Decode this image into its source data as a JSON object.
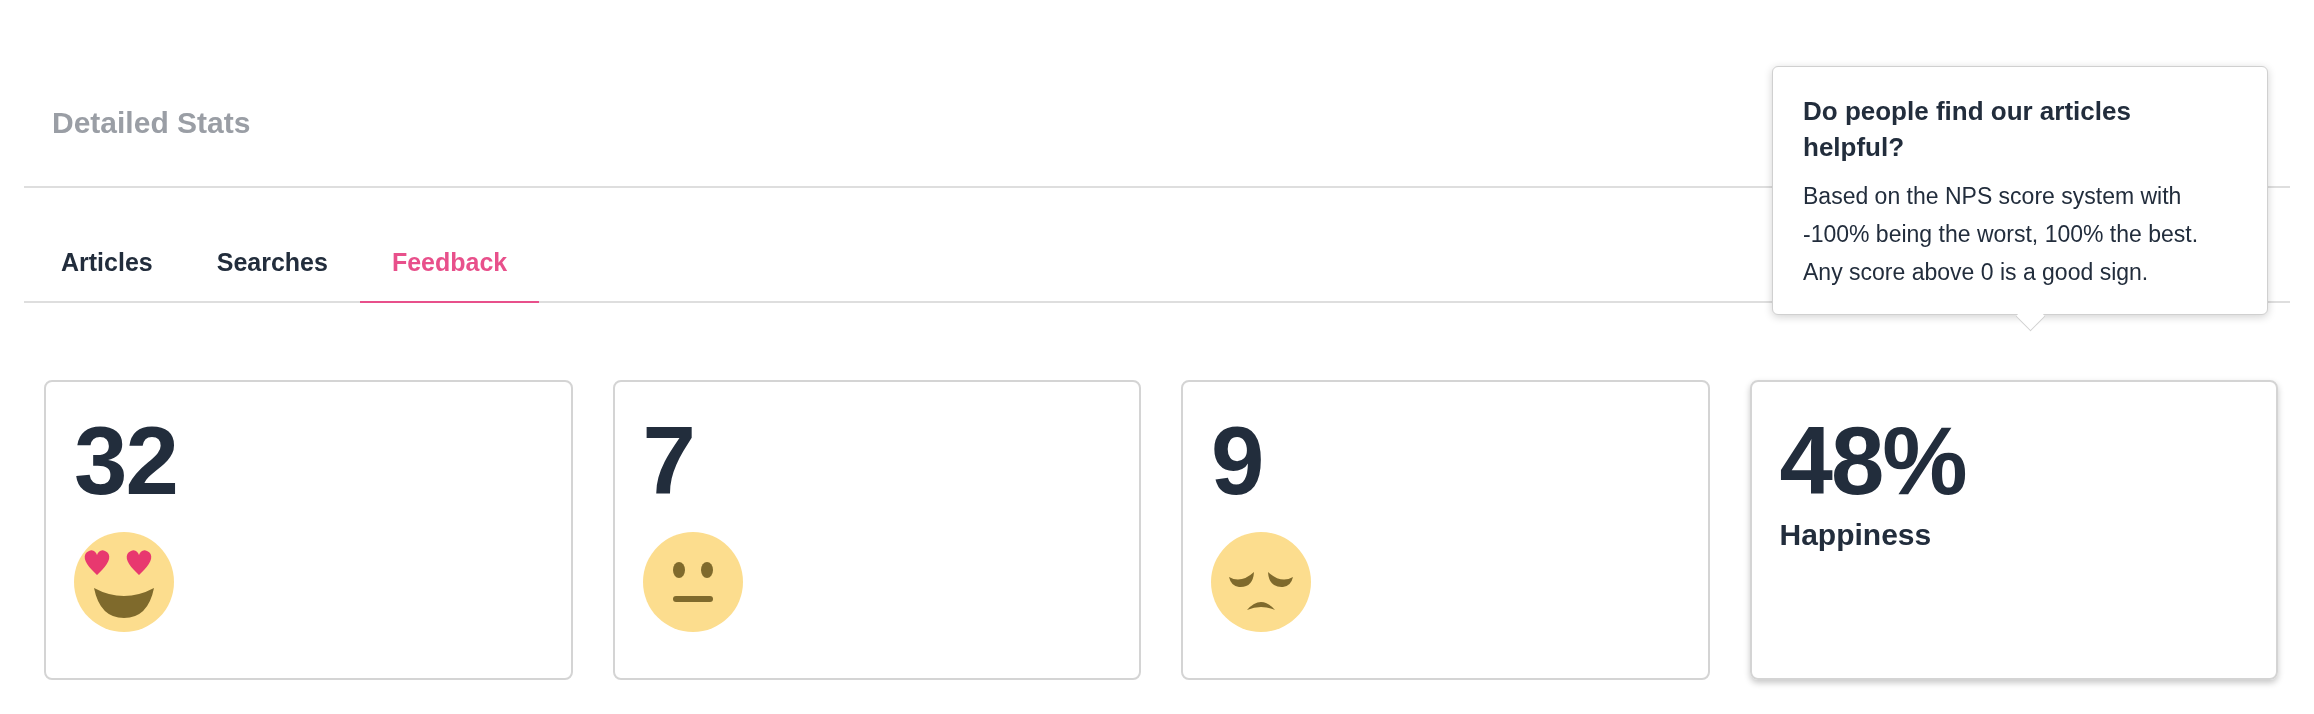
{
  "section_title": "Detailed Stats",
  "tabs": [
    {
      "label": "Articles",
      "selected": false
    },
    {
      "label": "Searches",
      "selected": false
    },
    {
      "label": "Feedback",
      "selected": true
    }
  ],
  "cards": [
    {
      "kind": "heart-eyes",
      "value": "32",
      "hovered": false
    },
    {
      "kind": "neutral",
      "value": "7",
      "hovered": false
    },
    {
      "kind": "sad",
      "value": "9",
      "hovered": false
    },
    {
      "kind": "label",
      "value": "48%",
      "label": "Happiness",
      "hovered": true
    }
  ],
  "tooltip": {
    "title": "Do people find our articles helpful?",
    "text": "Based on the NPS score system with -100% being the worst, 100% the best. Any score above 0 is a good sign."
  }
}
